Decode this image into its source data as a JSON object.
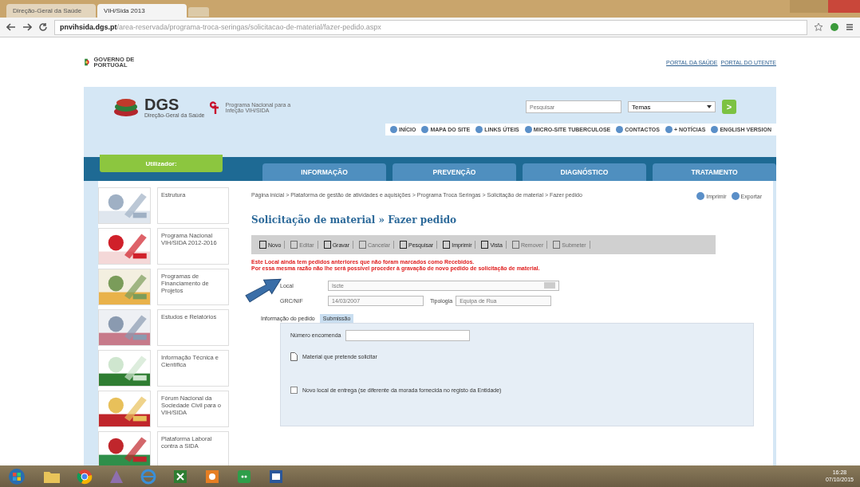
{
  "browser": {
    "tabs": [
      {
        "label": "Direção-Geral da Saúde",
        "selected": false
      },
      {
        "label": "VIH/Sida 2013",
        "selected": true
      }
    ],
    "url_host": "pnvihsida.dgs.pt",
    "url_path": "/area-reservada/programa-troca-seringas/solicitacao-de-material/fazer-pedido.aspx"
  },
  "header": {
    "gov_logo": "GOVERNO DE PORTUGAL",
    "links": [
      "PORTAL DA SAÚDE",
      "PORTAL DO UTENTE"
    ]
  },
  "banner": {
    "logo": "DGS",
    "logo_subtitle": "Direção-Geral da Saúde",
    "program": "Programa Nacional para a Infeção VIH/SIDA",
    "search": {
      "placeholder": "Pesquisar"
    },
    "select": "Temas",
    "go": ">",
    "links": [
      "INÍCIO",
      "MAPA DO SITE",
      "LINKS ÚTEIS",
      "MICRO-SITE TUBERCULOSE",
      "CONTACTOS",
      "+ NOTÍCIAS",
      "ENGLISH VERSION"
    ]
  },
  "user": {
    "label": "Utilizador:"
  },
  "nav": [
    "INFORMAÇÃO",
    "PREVENÇÃO",
    "DIAGNÓSTICO",
    "TRATAMENTO"
  ],
  "sidebar": {
    "items": [
      {
        "label": "Estrutura"
      },
      {
        "label": "Programa Nacional VIH/SIDA 2012-2016"
      },
      {
        "label": "Programas de Financiamento de Projetos"
      },
      {
        "label": "Estudos e Relatórios"
      },
      {
        "label": "Informação Técnica e Científica"
      },
      {
        "label": "Fórum Nacional da Sociedade Civil para o VIH/SIDA"
      },
      {
        "label": "Plataforma Laboral contra a SIDA"
      }
    ]
  },
  "breadcrumb": "Página inicial > Plataforma de gestão de atividades e aquisições > Programa Troca Seringas > Solicitação de material > Fazer pedido",
  "page_actions": [
    "Imprimir",
    "Exportar"
  ],
  "title": "Solicitação de material » Fazer pedido",
  "toolbar": [
    {
      "label": "Novo",
      "disabled": false
    },
    {
      "label": "Editar",
      "disabled": true
    },
    {
      "label": "Gravar",
      "disabled": false
    },
    {
      "label": "Cancelar",
      "disabled": true
    },
    {
      "label": "Pesquisar",
      "disabled": false
    },
    {
      "label": "Imprimir",
      "disabled": false
    },
    {
      "label": "Vista",
      "disabled": false
    },
    {
      "label": "Remover",
      "disabled": true
    },
    {
      "label": "Submeter",
      "disabled": true
    }
  ],
  "errors": [
    "Este Local ainda tem pedidos anteriores que não foram marcados como Recebidos.",
    "Por essa mesma razão não lhe será possível proceder à gravação de novo pedido de solicitação de material."
  ],
  "form": {
    "local_label": "Local",
    "local_value": "Iscte",
    "grc_label": "GRC/NIF",
    "grc_value": "14/03/2007",
    "tipologia_label": "Tipologia",
    "tipologia_value": "Equipa de Rua"
  },
  "form_tabs": [
    {
      "label": "Informação do pedido",
      "selected": false
    },
    {
      "label": "Submissão",
      "selected": true
    }
  ],
  "panel": {
    "order_label": "Número encomenda",
    "material_label": "Material que pretende solicitar",
    "new_location": {
      "label": "Novo local de entrega (se diferente da morada fornecida no registo da Entidade)",
      "checked": false
    }
  },
  "taskbar": {
    "time": "16:28",
    "date": "07/10/2015"
  }
}
